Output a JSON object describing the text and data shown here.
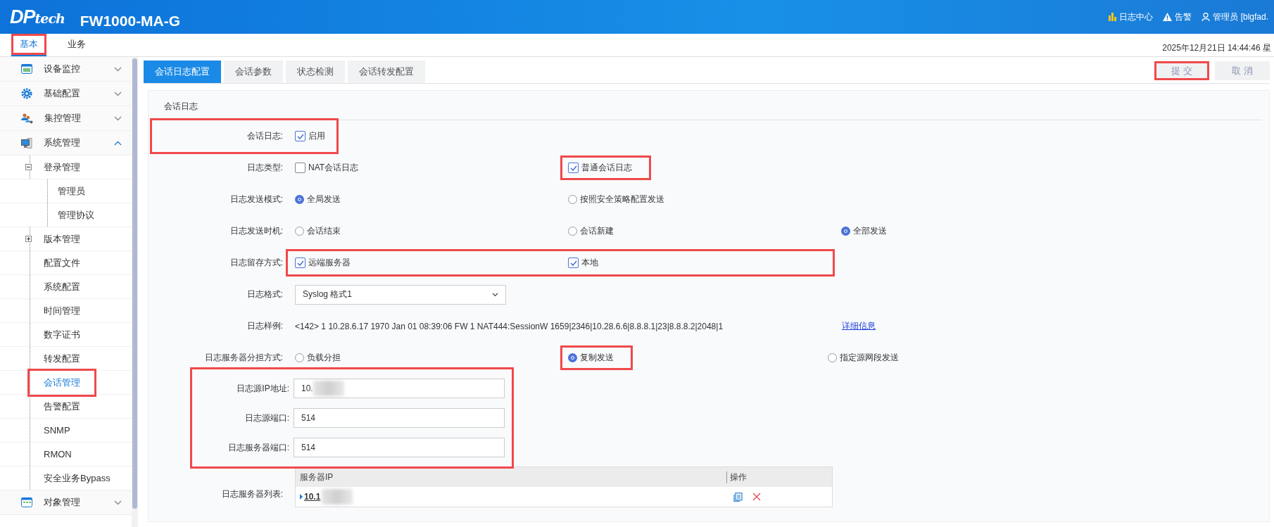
{
  "header": {
    "logo": {
      "main": "DP",
      "sub": "tech"
    },
    "product": "FW1000-MA-G",
    "links": [
      {
        "kind": "chart",
        "label": "日志中心"
      },
      {
        "kind": "warning",
        "label": "告警"
      },
      {
        "kind": "user",
        "label": "管理员 [blgfad."
      }
    ]
  },
  "nav": {
    "tabs": [
      {
        "label": "基本",
        "selected": true,
        "highlighted": true
      },
      {
        "label": "业务",
        "selected": false,
        "highlighted": false
      }
    ],
    "datetime": "2025年12月21日   14:44:46   星"
  },
  "sidebar": {
    "groups": [
      {
        "kind": "monitor",
        "label": "设备监控",
        "expanded": false
      },
      {
        "kind": "gear",
        "label": "基础配置",
        "expanded": false
      },
      {
        "kind": "users",
        "label": "集控管理",
        "expanded": false
      },
      {
        "kind": "computer",
        "label": "系统管理",
        "expanded": true,
        "children": [
          {
            "label": "登录管理",
            "expanded": true,
            "selected": false,
            "highlighted": false,
            "children": [
              {
                "label": "管理员",
                "selected": false,
                "highlighted": false
              },
              {
                "label": "管理协议",
                "selected": false,
                "highlighted": false
              }
            ]
          },
          {
            "label": "版本管理",
            "expanded": false,
            "selected": false,
            "highlighted": false
          },
          {
            "label": "配置文件",
            "selected": false,
            "highlighted": false
          },
          {
            "label": "系统配置",
            "selected": false,
            "highlighted": false
          },
          {
            "label": "时间管理",
            "selected": false,
            "highlighted": false
          },
          {
            "label": "数字证书",
            "selected": false,
            "highlighted": false
          },
          {
            "label": "转发配置",
            "selected": false,
            "highlighted": false
          },
          {
            "label": "会话管理",
            "selected": true,
            "highlighted": true
          },
          {
            "label": "告警配置",
            "selected": false,
            "highlighted": false
          },
          {
            "label": "SNMP",
            "selected": false,
            "highlighted": false
          },
          {
            "label": "RMON",
            "selected": false,
            "highlighted": false
          },
          {
            "label": "安全业务Bypass",
            "selected": false,
            "highlighted": false
          }
        ]
      },
      {
        "kind": "grid",
        "label": "对象管理",
        "expanded": false
      }
    ]
  },
  "tabs": [
    {
      "label": "会话日志配置",
      "selected": true
    },
    {
      "label": "会话参数",
      "selected": false
    },
    {
      "label": "状态检测",
      "selected": false
    },
    {
      "label": "会话转发配置",
      "selected": false
    }
  ],
  "actions": [
    {
      "label": "提 交",
      "highlighted": true,
      "disabled": true
    },
    {
      "label": "取 消",
      "highlighted": false,
      "disabled": true
    }
  ],
  "section": "会话日志",
  "rows": [
    {
      "kind": "checkbox",
      "label": "会话日志:",
      "highlighted": true,
      "values_highlighted": false,
      "options": [
        {
          "label": "启用",
          "checked": true,
          "highlighted": false
        }
      ]
    },
    {
      "kind": "checkbox",
      "label": "日志类型:",
      "highlighted": false,
      "values_highlighted": false,
      "options": [
        {
          "label": "NAT会话日志",
          "checked": false,
          "highlighted": false
        },
        {
          "label": "普通会话日志",
          "checked": true,
          "highlighted": true
        }
      ]
    },
    {
      "kind": "radio",
      "label": "日志发送模式:",
      "highlighted": false,
      "values_highlighted": false,
      "options": [
        {
          "label": "全局发送",
          "selected": true,
          "highlighted": false
        },
        {
          "label": "按照安全策略配置发送",
          "selected": false,
          "highlighted": false
        }
      ]
    },
    {
      "kind": "radio",
      "label": "日志发送时机:",
      "highlighted": false,
      "values_highlighted": false,
      "options": [
        {
          "label": "会话结束",
          "selected": false,
          "highlighted": false
        },
        {
          "label": "会话新建",
          "selected": false,
          "highlighted": false
        },
        {
          "label": "全部发送",
          "selected": true,
          "highlighted": false
        }
      ]
    },
    {
      "kind": "checkbox",
      "label": "日志留存方式:",
      "highlighted": false,
      "values_highlighted": true,
      "options": [
        {
          "label": "远端服务器",
          "checked": true,
          "highlighted": false
        },
        {
          "label": "本地",
          "checked": true,
          "highlighted": false
        }
      ]
    },
    {
      "kind": "select",
      "label": "日志格式:",
      "value": "Syslog 格式1"
    },
    {
      "kind": "sample",
      "label": "日志样例:",
      "text": "<142> 1 10.28.6.17 1970 Jan 01 08:39:06 FW 1 NAT444:SessionW 1659|2346|10.28.6.6|8.8.8.1|23|8.8.8.2|2048|1",
      "link": "详细信息"
    },
    {
      "kind": "radio",
      "label": "日志服务器分担方式:",
      "highlighted": false,
      "values_highlighted": false,
      "options": [
        {
          "label": "负载分担",
          "selected": false,
          "highlighted": false
        },
        {
          "label": "复制发送",
          "selected": true,
          "highlighted": true
        },
        {
          "label": "指定源网段发送",
          "selected": false,
          "highlighted": false
        }
      ]
    },
    {
      "kind": "fields",
      "highlighted": true,
      "fields": [
        {
          "label": "日志源IP地址:",
          "value": "10.",
          "blurred": true
        },
        {
          "label": "日志源端口:",
          "value": "514"
        },
        {
          "label": "日志服务器端口:",
          "value": "514"
        }
      ]
    },
    {
      "kind": "table",
      "label": "日志服务器列表:",
      "columns": [
        "服务器IP",
        "操作"
      ],
      "rows": [
        {
          "ip": "10.1",
          "blurred": true
        }
      ]
    }
  ]
}
